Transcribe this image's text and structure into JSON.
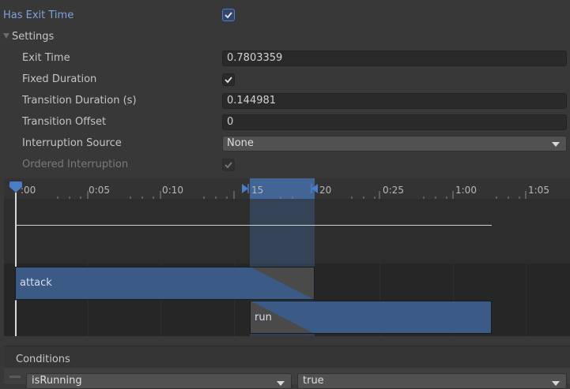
{
  "has_exit_time": {
    "label": "Has Exit Time",
    "checked": true
  },
  "settings": {
    "foldout_label": "Settings",
    "exit_time": {
      "label": "Exit Time",
      "value": "0.7803359"
    },
    "fixed_duration": {
      "label": "Fixed Duration",
      "checked": true
    },
    "transition_duration": {
      "label": "Transition Duration (s)",
      "value": "0.144981"
    },
    "transition_offset": {
      "label": "Transition Offset",
      "value": "0"
    },
    "interruption_source": {
      "label": "Interruption Source",
      "value": "None"
    },
    "ordered_interruption": {
      "label": "Ordered Interruption",
      "checked": true,
      "disabled": true
    }
  },
  "timeline": {
    "ticks": [
      "0:00",
      "0:05",
      "0:10",
      "0:15",
      "0:20",
      "0:25",
      "1:00",
      "1:05"
    ],
    "tick_display": [
      ":00",
      "0:05",
      "0:10",
      "15",
      "20",
      "0:25",
      "1:00",
      "1:05"
    ],
    "tracks": [
      {
        "name": "attack"
      },
      {
        "name": "run"
      }
    ]
  },
  "conditions": {
    "header": "Conditions",
    "rows": [
      {
        "parameter": "isRunning",
        "value": "true"
      }
    ]
  },
  "colors": {
    "accent_blue": "#4a7ec6",
    "panel_bg": "#383838",
    "field_bg": "#2a2a2a",
    "timeline_bg": "#2b2b2b",
    "clip_blue": "#3b5a86"
  },
  "icons": {
    "checkmark": "check-icon",
    "foldout": "triangle-down-icon",
    "dropdown_arrow": "chevron-down-icon",
    "playhead": "playhead-marker-icon"
  }
}
